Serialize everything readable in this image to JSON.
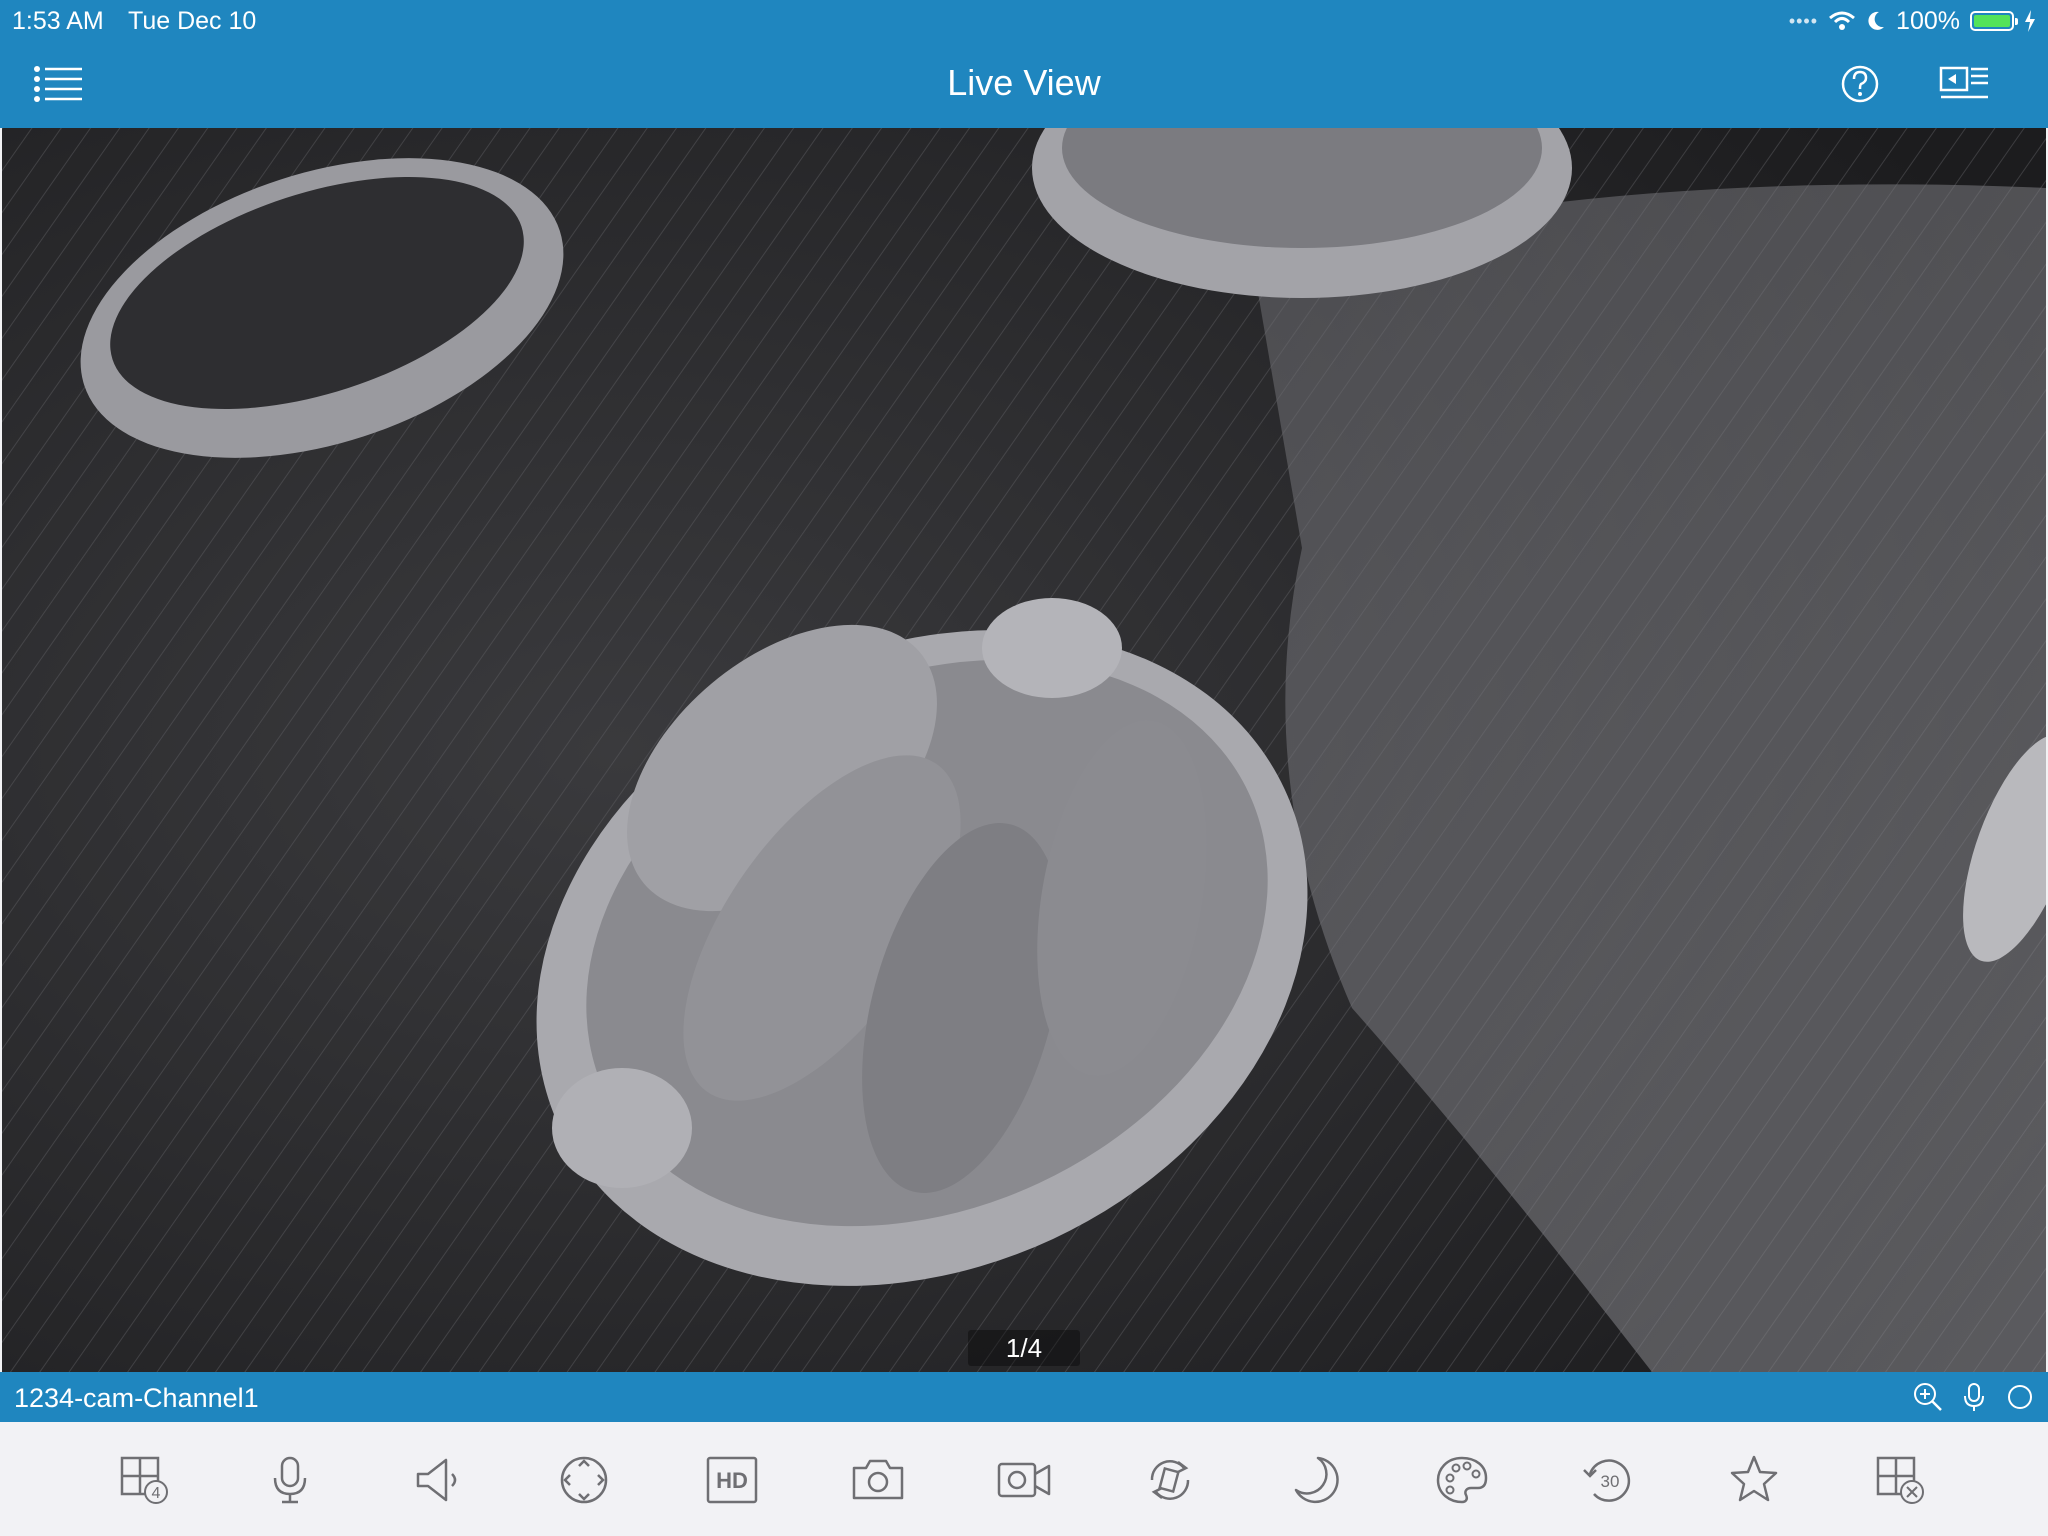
{
  "status_bar": {
    "time": "1:53 AM",
    "date": "Tue Dec 10",
    "battery": "100%",
    "battery_level": 1.0,
    "battery_color": "#54e35a"
  },
  "nav": {
    "title": "Live View",
    "icons": [
      "list-menu-icon",
      "help-icon",
      "device-list-icon"
    ]
  },
  "video": {
    "page_indicator": "1/4"
  },
  "channel_bar": {
    "name": "1234-cam-Channel1",
    "icons": [
      "zoom-in-icon",
      "microphone-icon",
      "record-indicator-icon"
    ]
  },
  "toolbar": {
    "icons": [
      "split-screen-4-icon",
      "microphone-icon",
      "speaker-icon",
      "ptz-icon",
      "hd-icon",
      "snapshot-icon",
      "record-video-icon",
      "flip-icon",
      "night-mode-icon",
      "color-palette-icon",
      "playback-30s-icon",
      "favorite-star-icon",
      "close-channel-icon"
    ],
    "hd_label": "HD",
    "split_count": "4",
    "playback_label": "30"
  },
  "colors": {
    "accent": "#1f86bf",
    "toolbar_bg": "#f2f2f5",
    "icon_gray": "#6f6f73"
  }
}
